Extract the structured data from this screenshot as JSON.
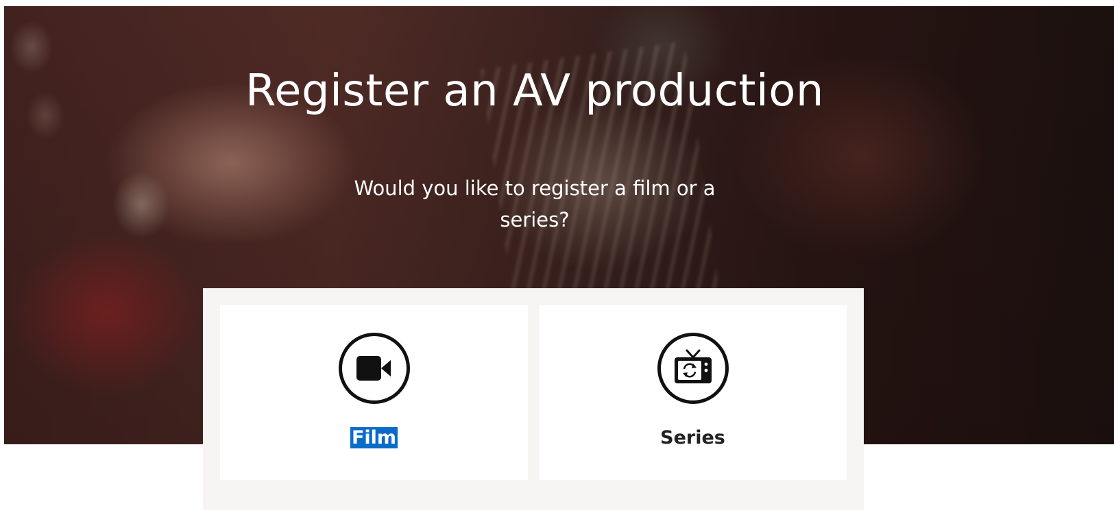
{
  "hero": {
    "title": "Register an AV production",
    "subtitle": "Would you like to register a film or a series?"
  },
  "options": [
    {
      "id": "film",
      "label": "Film",
      "icon": "video-camera-icon",
      "text_selected": true
    },
    {
      "id": "series",
      "label": "Series",
      "icon": "tv-series-icon",
      "text_selected": false
    }
  ],
  "colors": {
    "selection": "#0a6bc9",
    "icon_stroke": "#111111",
    "panel_bg": "#f6f5f3"
  }
}
